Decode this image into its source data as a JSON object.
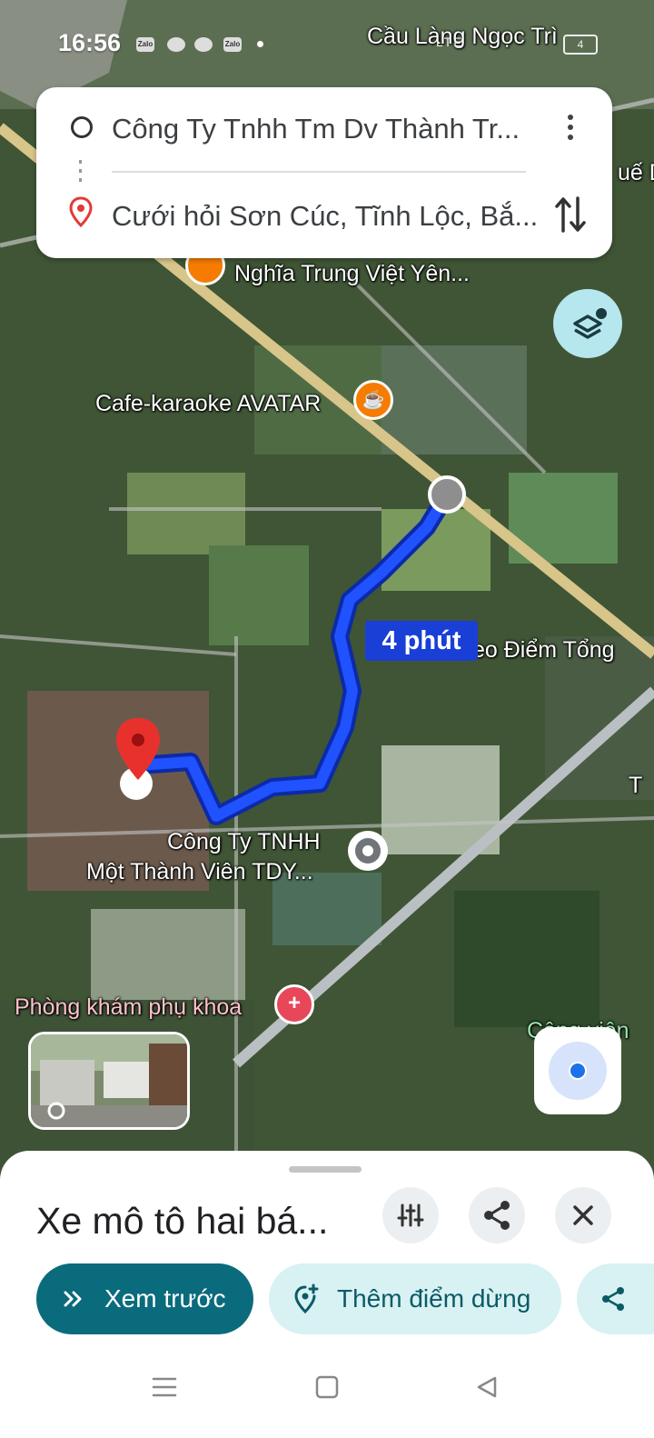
{
  "status_bar": {
    "time": "16:56",
    "notifications": [
      "Zalo",
      "chat",
      "messenger",
      "Zalo"
    ],
    "signal": "LTE",
    "battery": "4"
  },
  "directions": {
    "origin": "Công Ty Tnhh Tm Dv Thành Tr...",
    "destination": "Cưới hỏi Sơn Cúc, Tĩnh Lộc, Bắ..."
  },
  "map": {
    "labels": {
      "top_place": "Cầu Làng Ngọc Trì",
      "right_edge": "uế D",
      "nghia_trung": "Nghĩa Trung Việt Yên...",
      "cafe": "Cafe-karaoke AVATAR",
      "diem_tong": "eo Điểm Tổng",
      "right_t": "T",
      "company_line1": "Công Ty TNHH",
      "company_line2": "Một Thành Viên TDY...",
      "clinic": "Phòng khám phụ khoa",
      "bottom_right": "Công viên"
    },
    "eta": "4 phút"
  },
  "sheet": {
    "mode_title": "Xe mô tô hai bá...",
    "preview_label": "Xem trước",
    "add_stop_label": "Thêm điểm dừng"
  },
  "colors": {
    "route": "#1a3fd6",
    "primary_button": "#0a6b7c",
    "secondary_button": "#d8f1f3"
  }
}
